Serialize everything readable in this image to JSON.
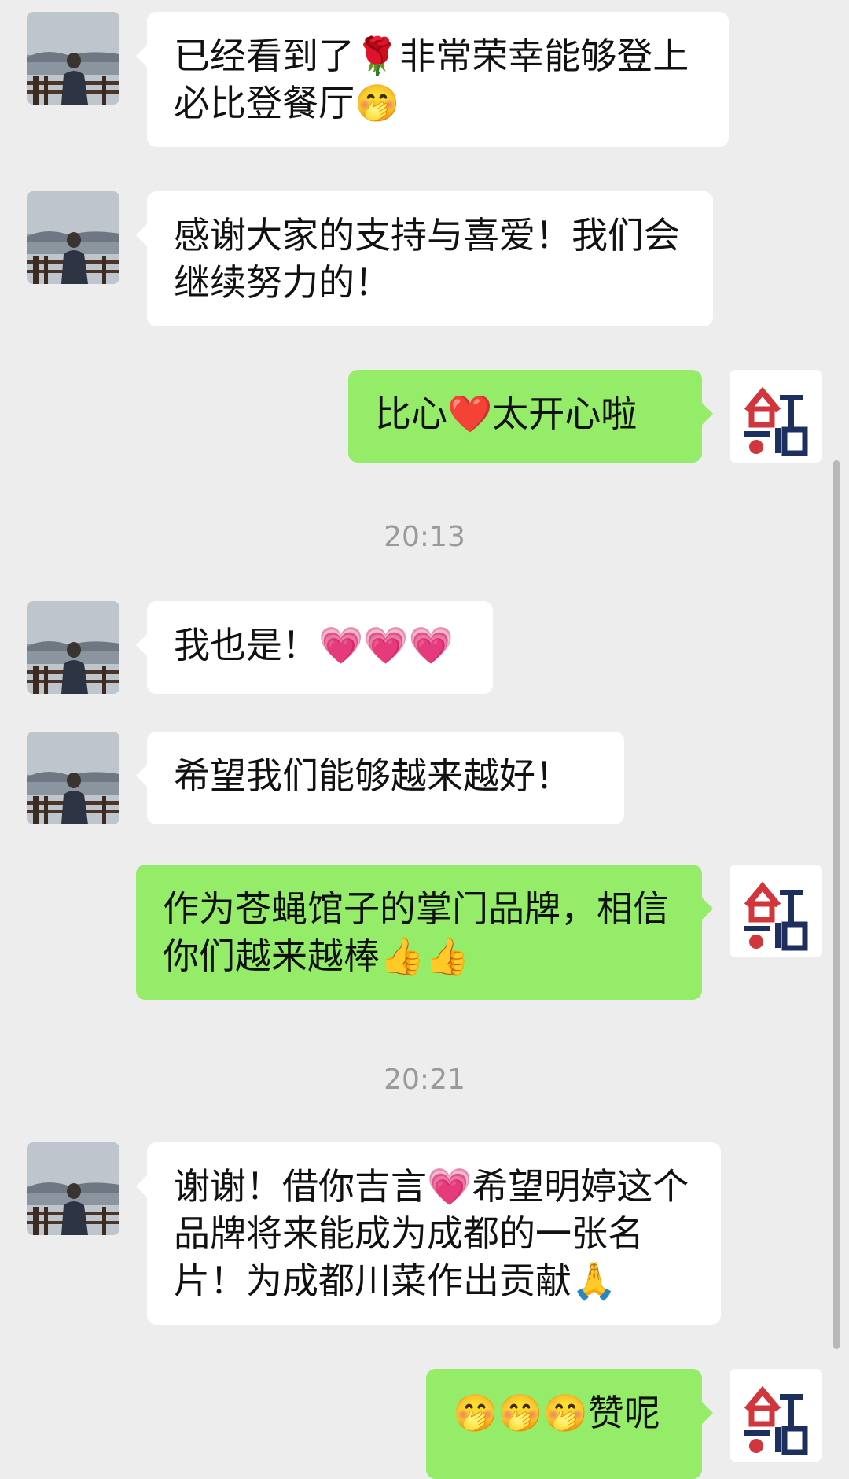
{
  "messages": [
    {
      "side": "left",
      "text": "已经看到了🌹非常荣幸能够登上必比登餐厅🤭"
    },
    {
      "side": "left",
      "text": "感谢大家的支持与喜爱！我们会继续努力的！"
    },
    {
      "side": "right",
      "text": "比心❤️太开心啦"
    },
    {
      "side": "left",
      "text": "我也是！💗💗💗"
    },
    {
      "side": "left",
      "text": "希望我们能够越来越好！"
    },
    {
      "side": "right",
      "text": "作为苍蝇馆子的掌门品牌，相信你们越来越棒👍👍"
    },
    {
      "side": "left",
      "text": "谢谢！借你吉言💗希望明婷这个品牌将来能成为成都的一张名片！为成都川菜作出贡献🙏"
    },
    {
      "side": "right",
      "text": "🤭🤭🤭赞呢"
    }
  ],
  "timestamps": [
    "20:13",
    "20:21"
  ],
  "brand_logo": {
    "text": "食不可挡"
  },
  "colors": {
    "background": "#ededed",
    "incoming_bubble": "#ffffff",
    "outgoing_bubble": "#95ec69",
    "timestamp": "#9a9a9a",
    "logo_red": "#d0363b",
    "logo_navy": "#1d2f5f"
  }
}
